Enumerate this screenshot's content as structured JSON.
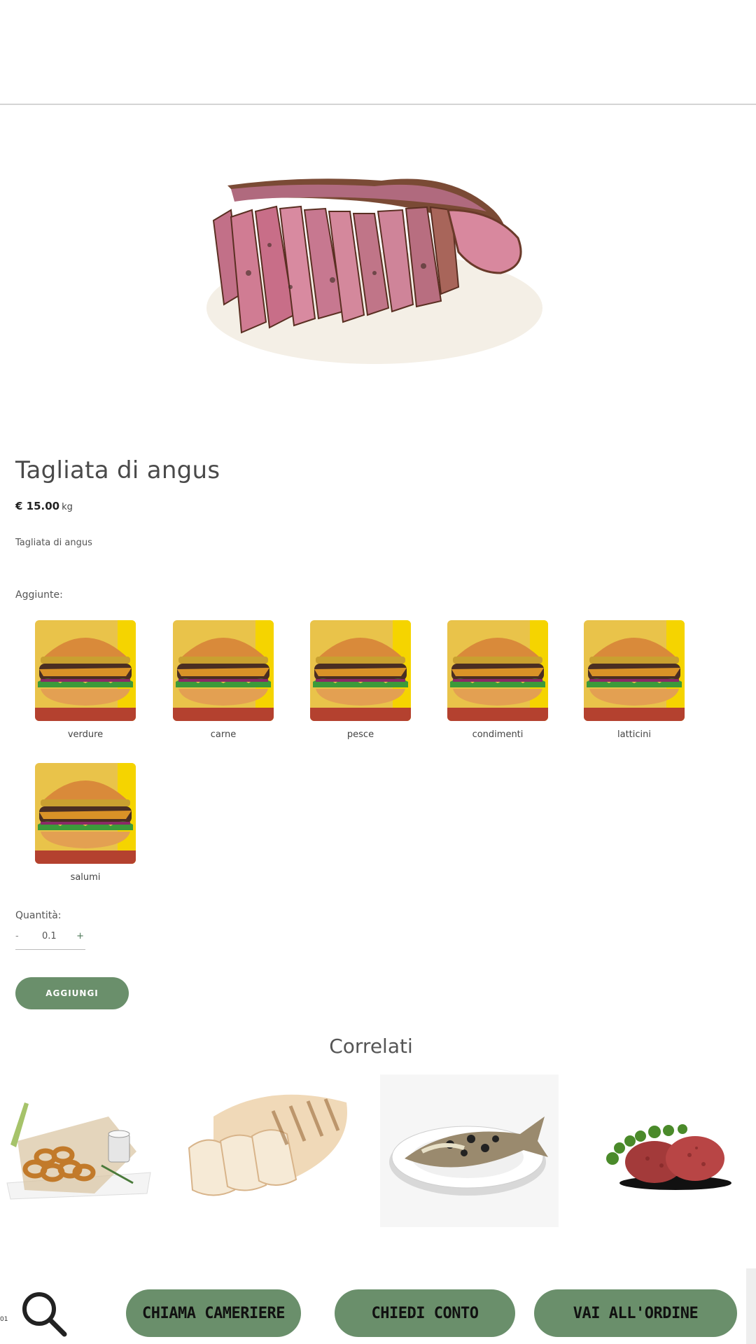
{
  "product": {
    "image_alt": "Tagliata di angus",
    "title": "Tagliata di angus",
    "price": "€ 15.00",
    "unit": "kg",
    "description": "Tagliata di angus"
  },
  "addons": {
    "label": "Aggiunte:",
    "items": [
      {
        "label": "verdure"
      },
      {
        "label": "carne"
      },
      {
        "label": "pesce"
      },
      {
        "label": "condimenti"
      },
      {
        "label": "latticini"
      },
      {
        "label": "salumi"
      }
    ]
  },
  "quantity": {
    "label": "Quantità:",
    "minus": "-",
    "value": "0.1",
    "plus": "+"
  },
  "add_button": "AGGIUNGI",
  "related": {
    "title": "Correlati"
  },
  "bottom": {
    "tiny_mark": "01",
    "call_waiter": "CHIAMA CAMERIERE",
    "ask_bill": "CHIEDI CONTO",
    "go_order": "VAI ALL'ORDINE"
  },
  "colors": {
    "accent": "#6a8f6b",
    "divider": "#d4d4d4"
  }
}
